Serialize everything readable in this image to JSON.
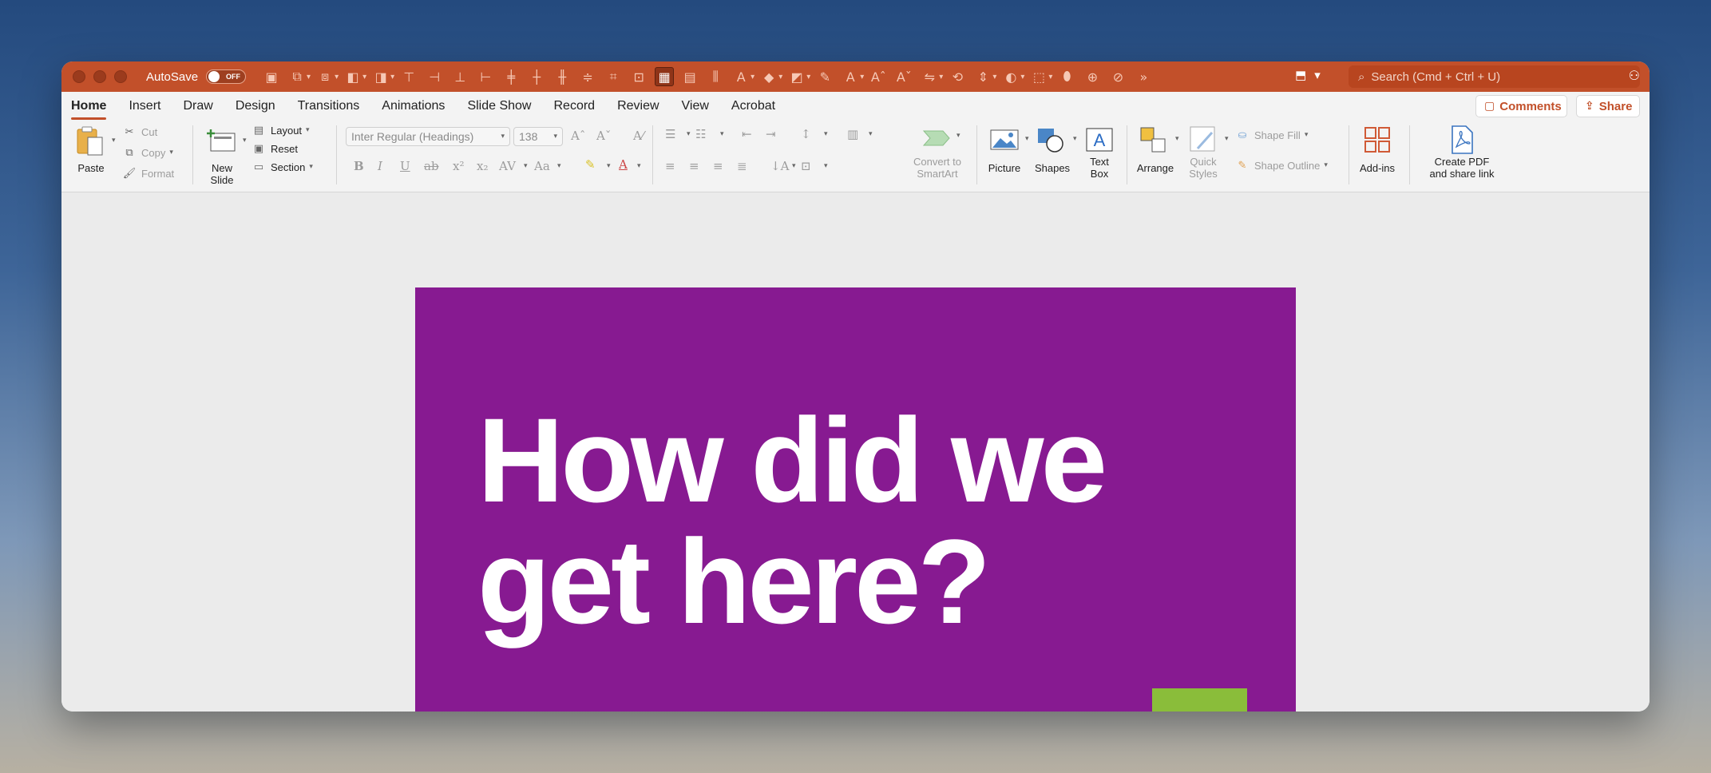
{
  "titlebar": {
    "autosave_label": "AutoSave",
    "autosave_state": "OFF",
    "search_placeholder": "Search (Cmd + Ctrl + U)"
  },
  "tabs": [
    "Home",
    "Insert",
    "Draw",
    "Design",
    "Transitions",
    "Animations",
    "Slide Show",
    "Record",
    "Review",
    "View",
    "Acrobat"
  ],
  "active_tab": "Home",
  "actions": {
    "comments": "Comments",
    "share": "Share"
  },
  "ribbon": {
    "clipboard": {
      "paste": "Paste",
      "cut": "Cut",
      "copy": "Copy",
      "format": "Format"
    },
    "slides": {
      "new_slide_line1": "New",
      "new_slide_line2": "Slide",
      "layout": "Layout",
      "reset": "Reset",
      "section": "Section"
    },
    "font": {
      "font_name": "Inter Regular (Headings)",
      "font_size": "138"
    },
    "convert_line1": "Convert to",
    "convert_line2": "SmartArt",
    "picture": "Picture",
    "shapes": "Shapes",
    "textbox_line1": "Text",
    "textbox_line2": "Box",
    "arrange": "Arrange",
    "quick_styles_line1": "Quick",
    "quick_styles_line2": "Styles",
    "shape_fill": "Shape Fill",
    "shape_outline": "Shape Outline",
    "addins": "Add-ins",
    "create_pdf_line1": "Create PDF",
    "create_pdf_line2": "and share link"
  },
  "slide": {
    "title_line1": "How did we",
    "title_line2": "get here?",
    "background": "#871a91",
    "accent": "#8abd3a"
  },
  "colors": {
    "titlebar": "#c2502a",
    "accent_text": "#c2502a"
  }
}
